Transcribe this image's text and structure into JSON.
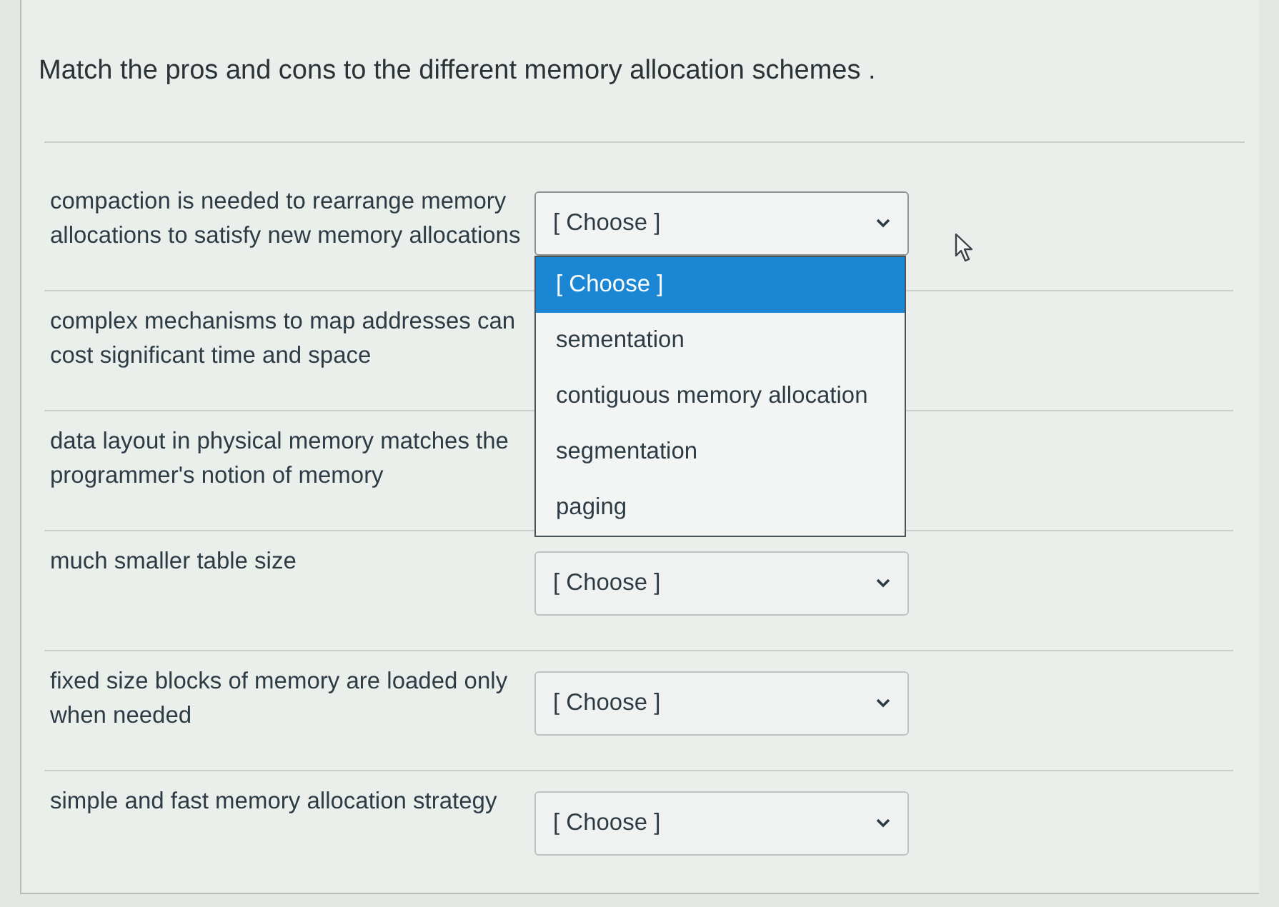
{
  "question": {
    "text": "Match the pros and cons to the different memory allocation schemes ."
  },
  "rows": [
    {
      "prompt": "compaction is needed to rearrange memory allocations to satisfy new memory allocations",
      "select": {
        "value": "[ Choose ]",
        "expanded": true,
        "options": [
          {
            "label": "[ Choose ]",
            "selected": true
          },
          {
            "label": "sementation",
            "selected": false
          },
          {
            "label": "contiguous memory allocation",
            "selected": false
          },
          {
            "label": "segmentation",
            "selected": false
          },
          {
            "label": "paging",
            "selected": false
          }
        ]
      }
    },
    {
      "prompt": "complex mechanisms to map addresses can cost significant time and space"
    },
    {
      "prompt": "data layout in physical memory matches the programmer's notion of memory"
    },
    {
      "prompt": "much smaller table size",
      "select": {
        "value": "[ Choose ]",
        "expanded": false
      }
    },
    {
      "prompt": "fixed size blocks of memory are loaded only when needed",
      "select": {
        "value": "[ Choose ]",
        "expanded": false
      }
    },
    {
      "prompt": "simple and fast memory allocation strategy",
      "select": {
        "value": "[ Choose ]",
        "expanded": false
      }
    }
  ]
}
